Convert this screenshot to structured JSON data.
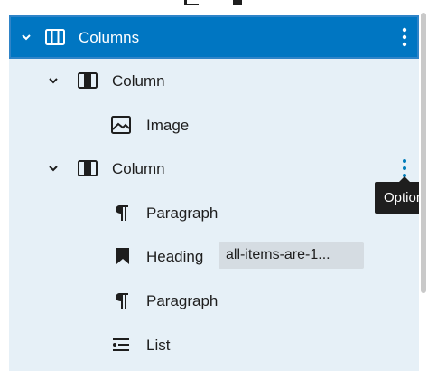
{
  "list_view": {
    "selected_item": {
      "label": "Columns",
      "icon": "columns-icon",
      "expanded": true
    },
    "items": [
      {
        "label": "Column",
        "icon": "column-icon",
        "expanded": true
      },
      {
        "label": "Image",
        "icon": "image-icon"
      },
      {
        "label": "Column",
        "icon": "column-icon",
        "expanded": true
      },
      {
        "label": "Paragraph",
        "icon": "paragraph-icon"
      },
      {
        "label": "Heading",
        "icon": "heading-icon",
        "anchor_badge": "all-items-are-1..."
      },
      {
        "label": "Paragraph",
        "icon": "paragraph-icon"
      },
      {
        "label": "List",
        "icon": "list-icon"
      }
    ],
    "tooltip": "Options"
  },
  "colors": {
    "selected_bg": "#0076c2",
    "panel_bg": "#e6f0f7",
    "text": "#1e1e1e",
    "accent": "#007cba",
    "badge_bg": "#d5dce2",
    "tooltip_bg": "#1e1e1e"
  }
}
